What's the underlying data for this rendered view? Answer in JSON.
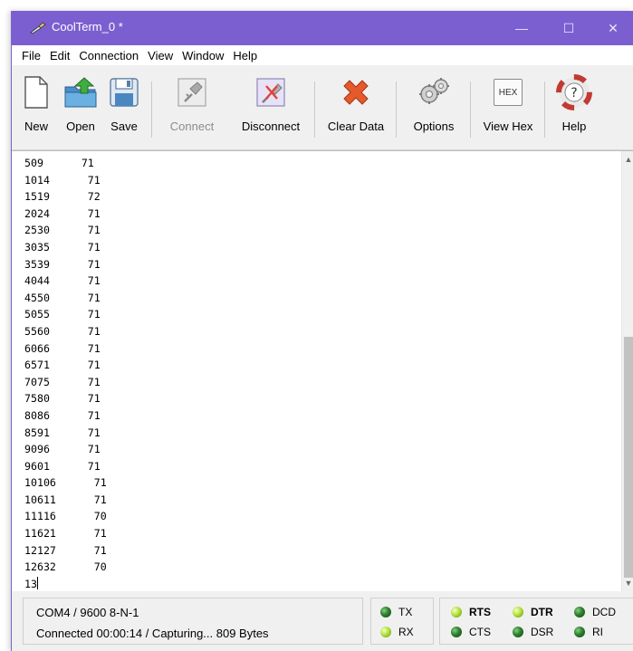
{
  "window": {
    "title": "CoolTerm_0 *"
  },
  "menu": [
    "File",
    "Edit",
    "Connection",
    "View",
    "Window",
    "Help"
  ],
  "toolbar": {
    "new": "New",
    "open": "Open",
    "save": "Save",
    "connect": "Connect",
    "disconnect": "Disconnect",
    "clear_data": "Clear Data",
    "options": "Options",
    "view_hex": "View Hex",
    "hex_badge": "HEX",
    "help": "Help"
  },
  "terminal": {
    "lines": [
      "509      71",
      "1014      71",
      "1519      72",
      "2024      71",
      "2530      71",
      "3035      71",
      "3539      71",
      "4044      71",
      "4550      71",
      "5055      71",
      "5560      71",
      "6066      71",
      "6571      71",
      "7075      71",
      "7580      71",
      "8086      71",
      "8591      71",
      "9096      71",
      "9601      71",
      "10106      71",
      "10611      71",
      "11116      70",
      "11621      71",
      "12127      71",
      "12632      70"
    ],
    "partial_line": "13"
  },
  "status": {
    "port": "COM4 / 9600 8-N-1",
    "connection": "Connected 00:00:14 / Capturing... 809 Bytes"
  },
  "leds": {
    "tx": "TX",
    "rx": "RX",
    "rts": "RTS",
    "cts": "CTS",
    "dtr": "DTR",
    "dsr": "DSR",
    "dcd": "DCD",
    "ri": "RI"
  },
  "colors": {
    "titlebar": "#7b5fd0",
    "led_on": "#b5e23a",
    "led_off": "#2f7d2f"
  }
}
